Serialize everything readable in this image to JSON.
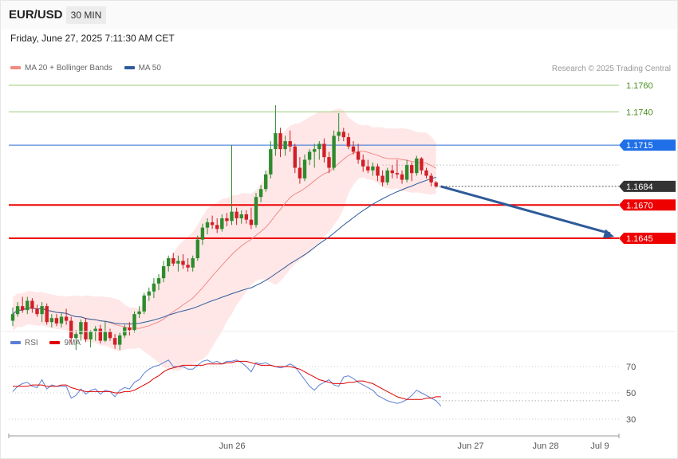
{
  "header": {
    "symbol": "EUR/USD",
    "timeframe": "30 MIN",
    "datetime": "Friday, June 27, 2025 7:11:30 AM CET",
    "credit": "Research © 2025 Trading Central"
  },
  "legend": {
    "main": [
      {
        "label": "MA 20 + Bollinger Bands",
        "color": "#f28b82"
      },
      {
        "label": "MA 50",
        "color": "#2f5a99"
      }
    ],
    "rsi": [
      {
        "label": "RSI",
        "color": "#5b7fd6"
      },
      {
        "label": "9MA",
        "color": "#e00000"
      }
    ]
  },
  "colors": {
    "bull": "#2e8b2e",
    "bear": "#d01f26",
    "band_fill": "#ffe3e3",
    "level_green": "#9ccc7a",
    "level_blue": "#2f6fd6",
    "level_red": "#ee0000",
    "arrow": "#2f5a99"
  },
  "chart_data": [
    {
      "type": "candlestick",
      "title": "",
      "ylim": [
        1.163,
        1.177
      ],
      "x_ticks": [
        "Jun 26",
        "Jun 27",
        "Jun 28",
        "Jul 9"
      ],
      "levels": [
        {
          "value": 1.176,
          "label": "1.1760",
          "style": "target-green"
        },
        {
          "value": 1.174,
          "label": "1.1740",
          "style": "target-green"
        },
        {
          "value": 1.1715,
          "label": "1.1715",
          "style": "pivot-blue"
        },
        {
          "value": 1.1684,
          "label": "1.1684",
          "style": "last-price"
        },
        {
          "value": 1.167,
          "label": "1.1670",
          "style": "support-red"
        },
        {
          "value": 1.1645,
          "label": "1.1645",
          "style": "support-red"
        }
      ],
      "projection": {
        "from": 1.1684,
        "to": 1.1645
      },
      "ohlc": [
        [
          1.1583,
          1.1593,
          1.1579,
          1.1588
        ],
        [
          1.1588,
          1.1597,
          1.1586,
          1.1594
        ],
        [
          1.1594,
          1.1601,
          1.1589,
          1.1591
        ],
        [
          1.1591,
          1.1601,
          1.1588,
          1.1598
        ],
        [
          1.1598,
          1.16,
          1.1589,
          1.1592
        ],
        [
          1.1592,
          1.1595,
          1.1586,
          1.1588
        ],
        [
          1.1588,
          1.1597,
          1.1582,
          1.1594
        ],
        [
          1.1594,
          1.1596,
          1.158,
          1.1582
        ],
        [
          1.1582,
          1.1588,
          1.1578,
          1.1585
        ],
        [
          1.1585,
          1.1588,
          1.1579,
          1.1581
        ],
        [
          1.1581,
          1.1589,
          1.1578,
          1.1586
        ],
        [
          1.1586,
          1.1592,
          1.158,
          1.1583
        ],
        [
          1.1583,
          1.1586,
          1.1566,
          1.157
        ],
        [
          1.157,
          1.1576,
          1.1561,
          1.1573
        ],
        [
          1.1573,
          1.1584,
          1.1568,
          1.1582
        ],
        [
          1.1582,
          1.1585,
          1.1567,
          1.1569
        ],
        [
          1.1569,
          1.1576,
          1.1563,
          1.1575
        ],
        [
          1.1575,
          1.1579,
          1.1568,
          1.1577
        ],
        [
          1.1577,
          1.158,
          1.1566,
          1.1568
        ],
        [
          1.1568,
          1.1583,
          1.1567,
          1.1575
        ],
        [
          1.1575,
          1.1577,
          1.1568,
          1.157
        ],
        [
          1.157,
          1.1573,
          1.1562,
          1.1565
        ],
        [
          1.1565,
          1.1574,
          1.1561,
          1.1572
        ],
        [
          1.1572,
          1.158,
          1.157,
          1.1578
        ],
        [
          1.1578,
          1.1582,
          1.1572,
          1.1576
        ],
        [
          1.1576,
          1.159,
          1.1574,
          1.1588
        ],
        [
          1.1588,
          1.1594,
          1.1585,
          1.159
        ],
        [
          1.159,
          1.1604,
          1.1588,
          1.1602
        ],
        [
          1.1602,
          1.1608,
          1.1598,
          1.1605
        ],
        [
          1.1605,
          1.1615,
          1.16,
          1.1611
        ],
        [
          1.1611,
          1.1618,
          1.1606,
          1.1615
        ],
        [
          1.1615,
          1.1628,
          1.1612,
          1.1624
        ],
        [
          1.1624,
          1.1632,
          1.162,
          1.163
        ],
        [
          1.163,
          1.1634,
          1.1624,
          1.1626
        ],
        [
          1.1626,
          1.1632,
          1.162,
          1.1628
        ],
        [
          1.1628,
          1.1633,
          1.1622,
          1.1625
        ],
        [
          1.1625,
          1.163,
          1.162,
          1.1623
        ],
        [
          1.1623,
          1.1632,
          1.162,
          1.163
        ],
        [
          1.163,
          1.1647,
          1.1628,
          1.1644
        ],
        [
          1.1644,
          1.1656,
          1.164,
          1.1653
        ],
        [
          1.1653,
          1.166,
          1.1648,
          1.1657
        ],
        [
          1.1657,
          1.1662,
          1.1652,
          1.1655
        ],
        [
          1.1655,
          1.166,
          1.1649,
          1.1652
        ],
        [
          1.1652,
          1.1663,
          1.165,
          1.166
        ],
        [
          1.166,
          1.1664,
          1.1654,
          1.1658
        ],
        [
          1.1658,
          1.1715,
          1.1655,
          1.1665
        ],
        [
          1.1665,
          1.1668,
          1.1655,
          1.166
        ],
        [
          1.166,
          1.1666,
          1.1656,
          1.1663
        ],
        [
          1.1663,
          1.1666,
          1.1656,
          1.1659
        ],
        [
          1.1659,
          1.1668,
          1.1652,
          1.1655
        ],
        [
          1.1655,
          1.1679,
          1.1653,
          1.1676
        ],
        [
          1.1676,
          1.1685,
          1.1672,
          1.1682
        ],
        [
          1.1682,
          1.1696,
          1.168,
          1.1693
        ],
        [
          1.1693,
          1.1718,
          1.169,
          1.1712
        ],
        [
          1.1712,
          1.1745,
          1.1707,
          1.1724
        ],
        [
          1.1724,
          1.1728,
          1.1706,
          1.1712
        ],
        [
          1.1712,
          1.1722,
          1.1707,
          1.1718
        ],
        [
          1.1718,
          1.1726,
          1.171,
          1.1714
        ],
        [
          1.1714,
          1.1716,
          1.1694,
          1.1698
        ],
        [
          1.1698,
          1.1706,
          1.1686,
          1.169
        ],
        [
          1.169,
          1.1708,
          1.1688,
          1.1704
        ],
        [
          1.1704,
          1.1712,
          1.17,
          1.171
        ],
        [
          1.171,
          1.1716,
          1.1698,
          1.1712
        ],
        [
          1.1712,
          1.1718,
          1.1704,
          1.1716
        ],
        [
          1.1716,
          1.172,
          1.1702,
          1.1706
        ],
        [
          1.1706,
          1.171,
          1.1694,
          1.1698
        ],
        [
          1.1698,
          1.1726,
          1.1696,
          1.1722
        ],
        [
          1.1722,
          1.1739,
          1.1718,
          1.1725
        ],
        [
          1.1725,
          1.1728,
          1.1718,
          1.1721
        ],
        [
          1.1721,
          1.1724,
          1.1712,
          1.1714
        ],
        [
          1.1714,
          1.1718,
          1.1708,
          1.171
        ],
        [
          1.171,
          1.1716,
          1.1701,
          1.1704
        ],
        [
          1.1704,
          1.1708,
          1.1695,
          1.1699
        ],
        [
          1.1699,
          1.1704,
          1.1694,
          1.1696
        ],
        [
          1.1696,
          1.1702,
          1.1692,
          1.1699
        ],
        [
          1.1699,
          1.1701,
          1.1688,
          1.1692
        ],
        [
          1.1692,
          1.1696,
          1.1684,
          1.1687
        ],
        [
          1.1687,
          1.1698,
          1.1685,
          1.1696
        ],
        [
          1.1696,
          1.17,
          1.169,
          1.1694
        ],
        [
          1.1694,
          1.1704,
          1.169,
          1.1693
        ],
        [
          1.1693,
          1.1696,
          1.1686,
          1.1689
        ],
        [
          1.1689,
          1.1704,
          1.1687,
          1.17
        ],
        [
          1.17,
          1.1702,
          1.1688,
          1.1694
        ],
        [
          1.1694,
          1.1707,
          1.1692,
          1.1705
        ],
        [
          1.1705,
          1.1706,
          1.1693,
          1.1696
        ],
        [
          1.1696,
          1.1698,
          1.169,
          1.1692
        ],
        [
          1.1692,
          1.1694,
          1.1684,
          1.1687
        ],
        [
          1.1687,
          1.1688,
          1.1683,
          1.1684
        ]
      ]
    },
    {
      "type": "line",
      "title": "",
      "ylim": [
        22,
        82
      ],
      "y_ticks": [
        30,
        50,
        70
      ],
      "series": [
        {
          "name": "RSI",
          "values": [
            51,
            55,
            57,
            58,
            55,
            54,
            60,
            53,
            56,
            55,
            55,
            55,
            46,
            48,
            53,
            49,
            52,
            53,
            49,
            52,
            51,
            47,
            52,
            54,
            53,
            58,
            60,
            65,
            68,
            70,
            71,
            73,
            75,
            70,
            70,
            70,
            68,
            68,
            71,
            74,
            75,
            73,
            74,
            72,
            74,
            74,
            75,
            73,
            70,
            66,
            73,
            72,
            73,
            71,
            70,
            69,
            70,
            72,
            70,
            65,
            60,
            55,
            52,
            56,
            58,
            60,
            56,
            55,
            62,
            63,
            61,
            58,
            56,
            54,
            52,
            48,
            46,
            44,
            43,
            42,
            43,
            45,
            48,
            52,
            50,
            48,
            46,
            44,
            40
          ]
        },
        {
          "name": "9MA",
          "values": [
            55,
            55,
            55,
            55,
            56,
            56,
            56,
            55,
            55,
            55,
            56,
            56,
            54,
            53,
            52,
            51,
            51,
            51,
            51,
            51,
            51,
            50,
            50,
            51,
            51,
            52,
            54,
            56,
            58,
            61,
            63,
            66,
            68,
            69,
            70,
            71,
            71,
            71,
            71,
            71,
            72,
            72,
            72,
            72,
            73,
            73,
            74,
            74,
            74,
            73,
            72,
            71,
            71,
            71,
            70,
            70,
            70,
            70,
            69,
            68,
            66,
            64,
            62,
            60,
            59,
            58,
            57,
            57,
            57,
            58,
            58,
            59,
            59,
            58,
            57,
            55,
            53,
            51,
            49,
            47,
            46,
            45,
            45,
            45,
            45,
            46,
            46,
            47,
            47
          ]
        }
      ]
    }
  ]
}
